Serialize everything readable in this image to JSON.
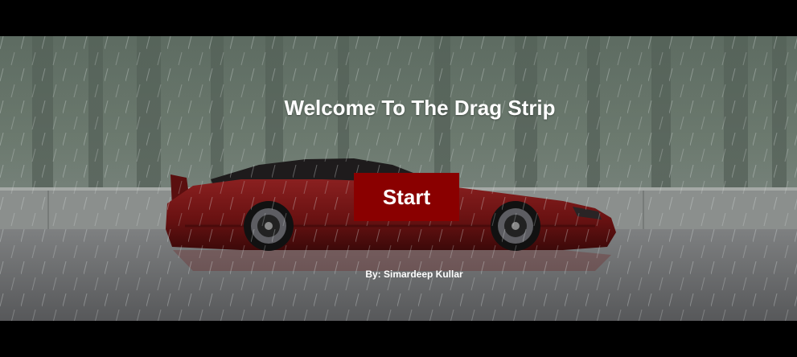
{
  "title": "Welcome To The Drag Strip",
  "start_button": {
    "label": "Start"
  },
  "credit": "By: Simardeep Kullar",
  "colors": {
    "button_bg": "#8a0000",
    "text": "#ffffff",
    "car_body": "#6e1414",
    "letterbox": "#000000"
  }
}
